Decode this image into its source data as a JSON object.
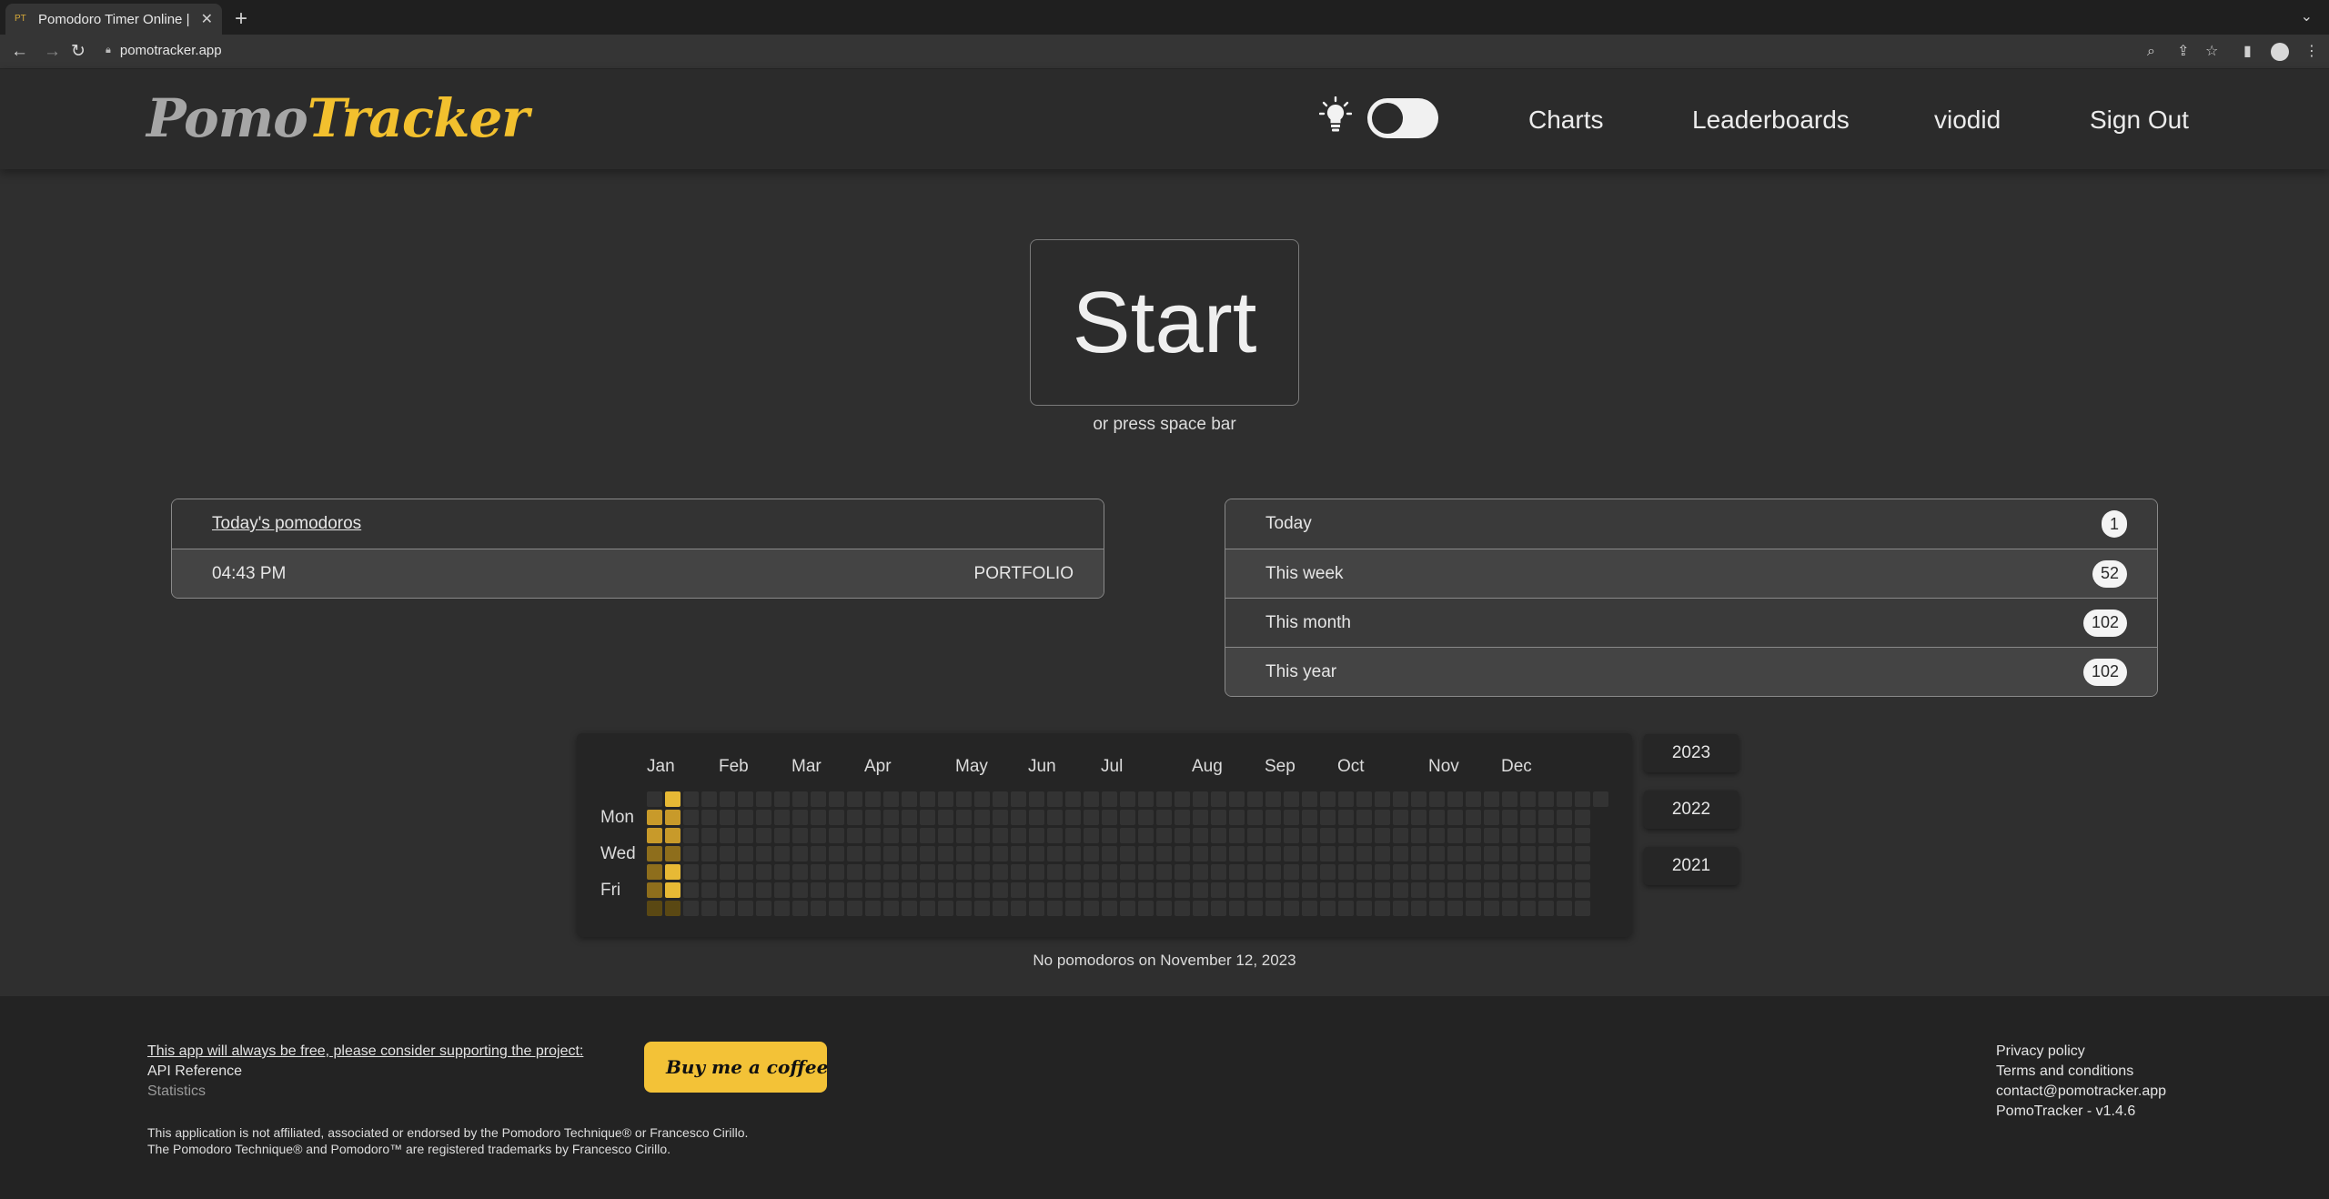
{
  "browser": {
    "tab_title": "Pomodoro Timer Online |",
    "tab_favicon": "PT",
    "new_tab_label": "+",
    "tab_menu_label": "⌄",
    "url": "pomotracker.app"
  },
  "header": {
    "logo_part1": "Pomo",
    "logo_part2": "Tracker",
    "nav": {
      "charts": "Charts",
      "leaderboards": "Leaderboards",
      "username": "viodid",
      "sign_out": "Sign Out"
    },
    "theme_toggle_on": false
  },
  "timer": {
    "start_label": "Start",
    "hint": "or press space bar"
  },
  "today_panel": {
    "title": "Today's pomodoros",
    "entries": [
      {
        "time": "04:43 PM",
        "tag": "PORTFOLIO"
      }
    ]
  },
  "stats_panel": {
    "rows": [
      {
        "label": "Today",
        "value": "1"
      },
      {
        "label": "This week",
        "value": "52"
      },
      {
        "label": "This month",
        "value": "102"
      },
      {
        "label": "This year",
        "value": "102"
      }
    ]
  },
  "heatmap": {
    "months": [
      "Jan",
      "Feb",
      "Mar",
      "Apr",
      "May",
      "Jun",
      "Jul",
      "Aug",
      "Sep",
      "Oct",
      "Nov",
      "Dec"
    ],
    "weekday_labels": [
      "Mon",
      "Wed",
      "Fri"
    ],
    "years": [
      "2023",
      "2022",
      "2021"
    ],
    "caption": "No pomodoros on November 12, 2023",
    "colors": {
      "empty": "#333333",
      "level1": "#5a4813",
      "level2": "#8e6e1c",
      "level3": "#c89a2a",
      "level4": "#e7b935"
    },
    "active_cells": [
      {
        "week": 0,
        "day": 1,
        "level": 3
      },
      {
        "week": 0,
        "day": 2,
        "level": 3
      },
      {
        "week": 0,
        "day": 3,
        "level": 2
      },
      {
        "week": 0,
        "day": 4,
        "level": 2
      },
      {
        "week": 0,
        "day": 5,
        "level": 2
      },
      {
        "week": 0,
        "day": 6,
        "level": 1
      },
      {
        "week": 1,
        "day": 0,
        "level": 4
      },
      {
        "week": 1,
        "day": 1,
        "level": 3
      },
      {
        "week": 1,
        "day": 2,
        "level": 3
      },
      {
        "week": 1,
        "day": 3,
        "level": 2
      },
      {
        "week": 1,
        "day": 4,
        "level": 4
      },
      {
        "week": 1,
        "day": 5,
        "level": 4
      },
      {
        "week": 1,
        "day": 6,
        "level": 1
      }
    ]
  },
  "footer": {
    "support_text": "This app will always be free, please consider supporting the project:",
    "api_reference": "API Reference",
    "statistics": "Statistics",
    "coffee_label": "Buy me a coffee",
    "disclaimer_line1": "This application is not affiliated, associated or endorsed by the Pomodoro Technique® or Francesco Cirillo.",
    "disclaimer_line2": "The Pomodoro Technique® and Pomodoro™ are registered trademarks by Francesco Cirillo.",
    "privacy_policy": "Privacy policy",
    "terms": "Terms and conditions",
    "contact": "contact@pomotracker.app",
    "version": "PomoTracker - v1.4.6"
  }
}
